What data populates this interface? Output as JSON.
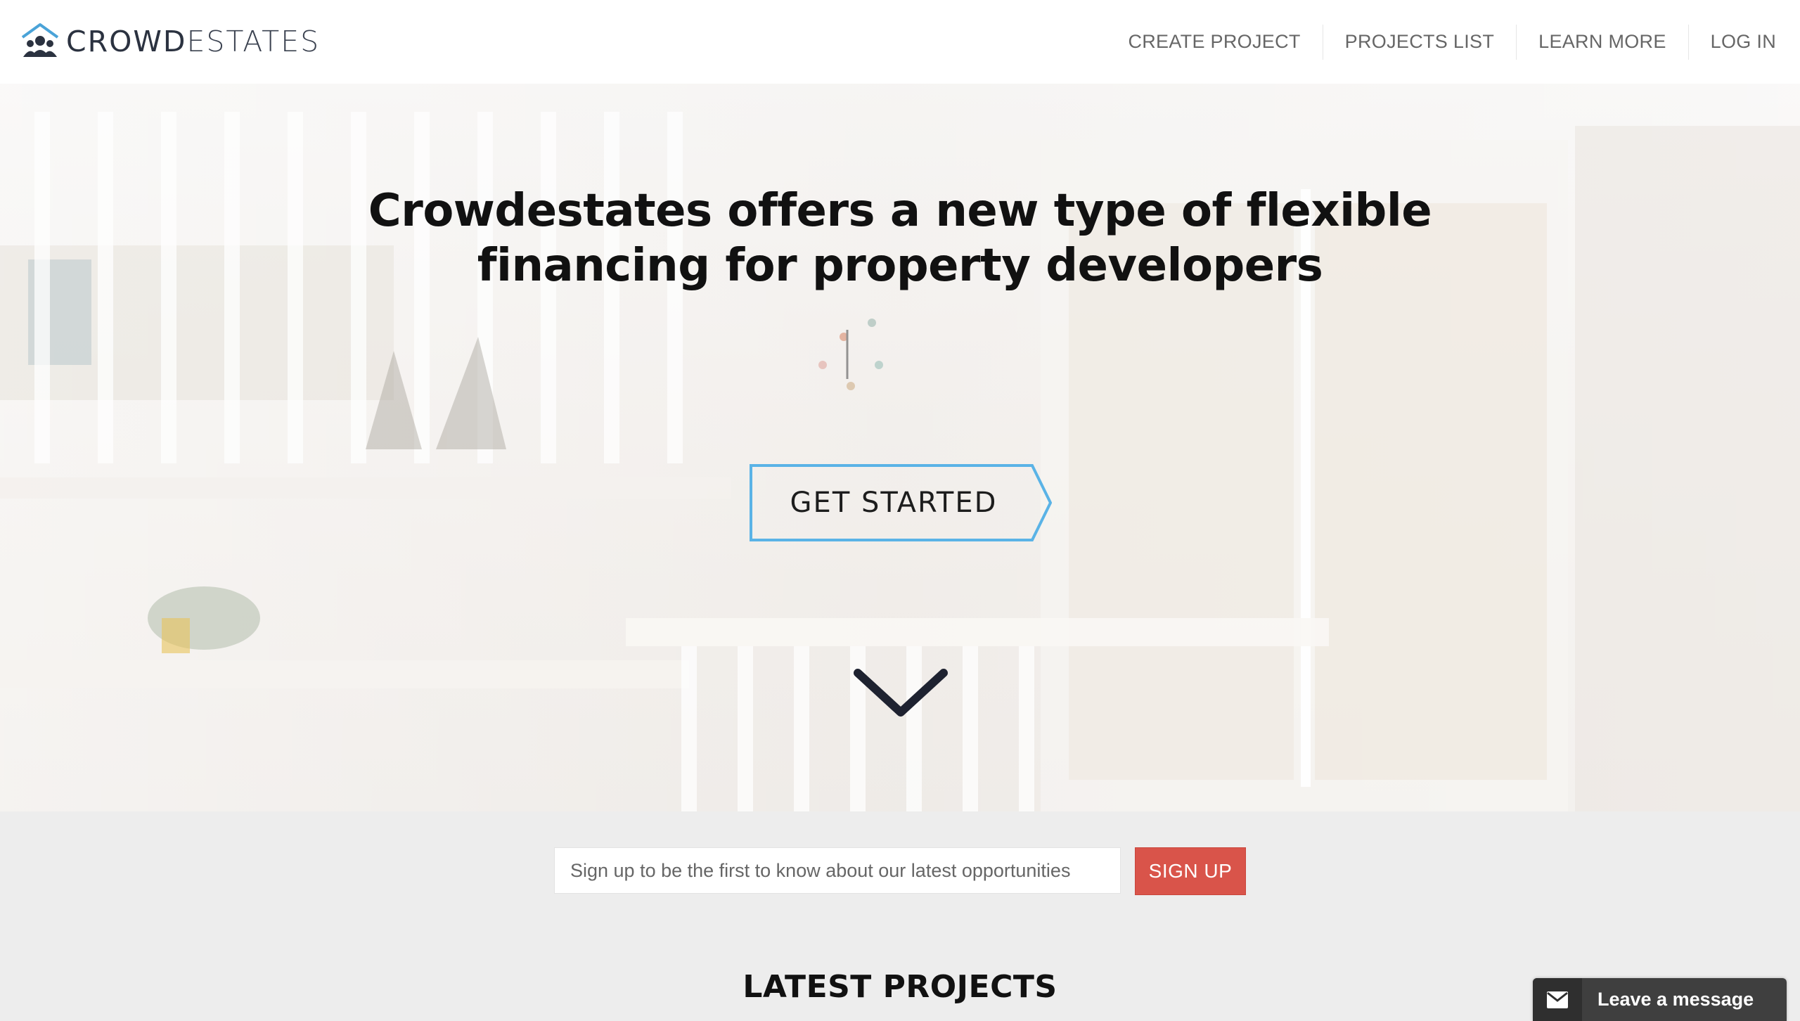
{
  "brand": {
    "name_bold": "CROWD",
    "name_light": "ESTATES",
    "logo_icon": "house-people-icon",
    "logo_color": "#4aa3d8"
  },
  "nav": {
    "items": [
      {
        "label": "CREATE PROJECT"
      },
      {
        "label": "PROJECTS LIST"
      },
      {
        "label": "LEARN MORE"
      },
      {
        "label": "LOG IN"
      }
    ]
  },
  "hero": {
    "title_line1": "Crowdestates offers a new type of flexible",
    "title_line2": "financing for property developers",
    "cta_label": "GET STARTED",
    "cta_border_color": "#5ab3e6",
    "scroll_icon": "chevron-down-icon",
    "scroll_icon_color": "#1e2230"
  },
  "signup": {
    "placeholder": "Sign up to be the first to know about our latest opportunities",
    "button_label": "SIGN UP",
    "button_color": "#d9544a"
  },
  "latest": {
    "title": "LATEST PROJECTS"
  },
  "chat": {
    "label": "Leave a message",
    "icon": "envelope-icon"
  }
}
